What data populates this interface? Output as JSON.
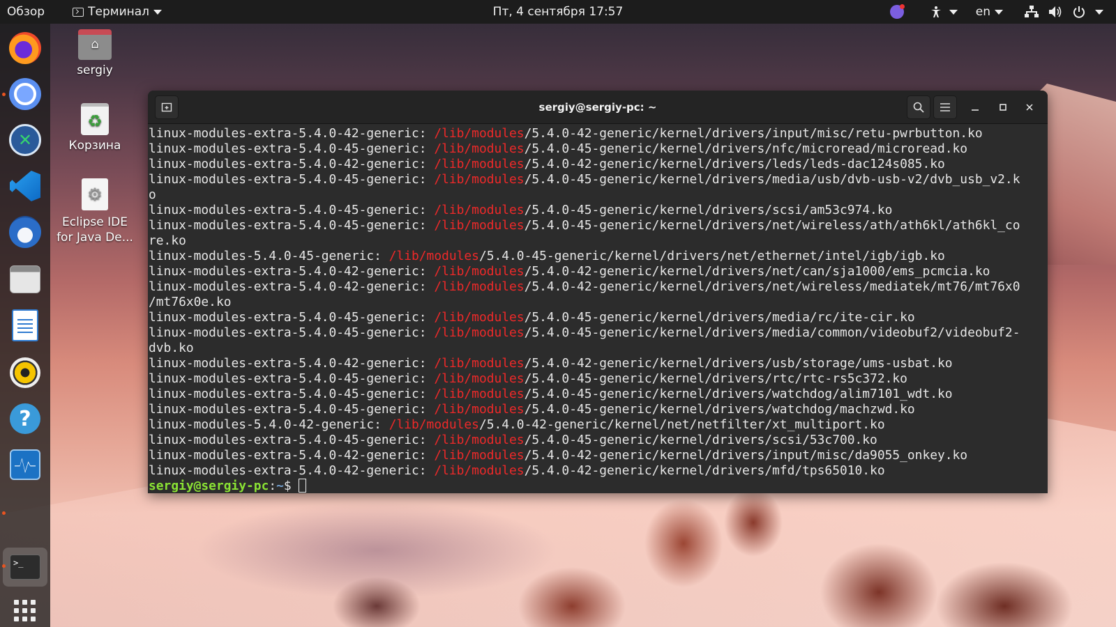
{
  "topbar": {
    "activities": "Обзор",
    "app_menu": "Терминал",
    "clock": "Пт, 4 сентября  17:57",
    "lang": "en",
    "icons": [
      "viber-icon",
      "accessibility-icon",
      "network-icon",
      "volume-icon",
      "power-icon"
    ]
  },
  "dock": {
    "items": [
      "firefox-icon",
      "chromium-icon",
      "x-browser-icon",
      "vscode-icon",
      "thunderbird-icon",
      "files-icon",
      "writer-icon",
      "rhythmbox-icon",
      "help-icon",
      "system-monitor-icon",
      "terminal-icon",
      "show-apps-icon"
    ]
  },
  "desktop": {
    "home_label": "sergiy",
    "trash_label": "Корзина",
    "eclipse_label_1": "Eclipse IDE",
    "eclipse_label_2": "for Java De..."
  },
  "terminal": {
    "title": "sergiy@sergiy-pc: ~",
    "prompt_user": "sergiy@sergiy-pc",
    "prompt_sep": ":",
    "prompt_path": "~",
    "prompt_sym": "$ ",
    "lines": [
      {
        "pkg": "linux-modules-extra-5.4.0-42-generic: ",
        "hl": "/lib/modules",
        "rest": "/5.4.0-42-generic/kernel/drivers/input/misc/retu-pwrbutton.ko"
      },
      {
        "pkg": "linux-modules-extra-5.4.0-45-generic: ",
        "hl": "/lib/modules",
        "rest": "/5.4.0-45-generic/kernel/drivers/nfc/microread/microread.ko"
      },
      {
        "pkg": "linux-modules-extra-5.4.0-42-generic: ",
        "hl": "/lib/modules",
        "rest": "/5.4.0-42-generic/kernel/drivers/leds/leds-dac124s085.ko"
      },
      {
        "pkg": "linux-modules-extra-5.4.0-45-generic: ",
        "hl": "/lib/modules",
        "rest": "/5.4.0-45-generic/kernel/drivers/media/usb/dvb-usb-v2/dvb_usb_v2.k"
      },
      {
        "pkg": "",
        "hl": "",
        "rest": "o"
      },
      {
        "pkg": "linux-modules-extra-5.4.0-45-generic: ",
        "hl": "/lib/modules",
        "rest": "/5.4.0-45-generic/kernel/drivers/scsi/am53c974.ko"
      },
      {
        "pkg": "linux-modules-extra-5.4.0-45-generic: ",
        "hl": "/lib/modules",
        "rest": "/5.4.0-45-generic/kernel/drivers/net/wireless/ath/ath6kl/ath6kl_co"
      },
      {
        "pkg": "",
        "hl": "",
        "rest": "re.ko"
      },
      {
        "pkg": "linux-modules-5.4.0-45-generic: ",
        "hl": "/lib/modules",
        "rest": "/5.4.0-45-generic/kernel/drivers/net/ethernet/intel/igb/igb.ko"
      },
      {
        "pkg": "linux-modules-extra-5.4.0-42-generic: ",
        "hl": "/lib/modules",
        "rest": "/5.4.0-42-generic/kernel/drivers/net/can/sja1000/ems_pcmcia.ko"
      },
      {
        "pkg": "linux-modules-extra-5.4.0-42-generic: ",
        "hl": "/lib/modules",
        "rest": "/5.4.0-42-generic/kernel/drivers/net/wireless/mediatek/mt76/mt76x0"
      },
      {
        "pkg": "",
        "hl": "",
        "rest": "/mt76x0e.ko"
      },
      {
        "pkg": "linux-modules-extra-5.4.0-45-generic: ",
        "hl": "/lib/modules",
        "rest": "/5.4.0-45-generic/kernel/drivers/media/rc/ite-cir.ko"
      },
      {
        "pkg": "linux-modules-extra-5.4.0-45-generic: ",
        "hl": "/lib/modules",
        "rest": "/5.4.0-45-generic/kernel/drivers/media/common/videobuf2/videobuf2-"
      },
      {
        "pkg": "",
        "hl": "",
        "rest": "dvb.ko"
      },
      {
        "pkg": "linux-modules-extra-5.4.0-42-generic: ",
        "hl": "/lib/modules",
        "rest": "/5.4.0-42-generic/kernel/drivers/usb/storage/ums-usbat.ko"
      },
      {
        "pkg": "linux-modules-extra-5.4.0-45-generic: ",
        "hl": "/lib/modules",
        "rest": "/5.4.0-45-generic/kernel/drivers/rtc/rtc-rs5c372.ko"
      },
      {
        "pkg": "linux-modules-extra-5.4.0-45-generic: ",
        "hl": "/lib/modules",
        "rest": "/5.4.0-45-generic/kernel/drivers/watchdog/alim7101_wdt.ko"
      },
      {
        "pkg": "linux-modules-extra-5.4.0-45-generic: ",
        "hl": "/lib/modules",
        "rest": "/5.4.0-45-generic/kernel/drivers/watchdog/machzwd.ko"
      },
      {
        "pkg": "linux-modules-5.4.0-42-generic: ",
        "hl": "/lib/modules",
        "rest": "/5.4.0-42-generic/kernel/net/netfilter/xt_multiport.ko"
      },
      {
        "pkg": "linux-modules-extra-5.4.0-45-generic: ",
        "hl": "/lib/modules",
        "rest": "/5.4.0-45-generic/kernel/drivers/scsi/53c700.ko"
      },
      {
        "pkg": "linux-modules-extra-5.4.0-42-generic: ",
        "hl": "/lib/modules",
        "rest": "/5.4.0-42-generic/kernel/drivers/input/misc/da9055_onkey.ko"
      },
      {
        "pkg": "linux-modules-extra-5.4.0-42-generic: ",
        "hl": "/lib/modules",
        "rest": "/5.4.0-42-generic/kernel/drivers/mfd/tps65010.ko"
      }
    ]
  },
  "colors": {
    "highlight": "#ef2929",
    "prompt_user": "#8ae234",
    "prompt_path": "#729fcf",
    "accent": "#e95420"
  }
}
